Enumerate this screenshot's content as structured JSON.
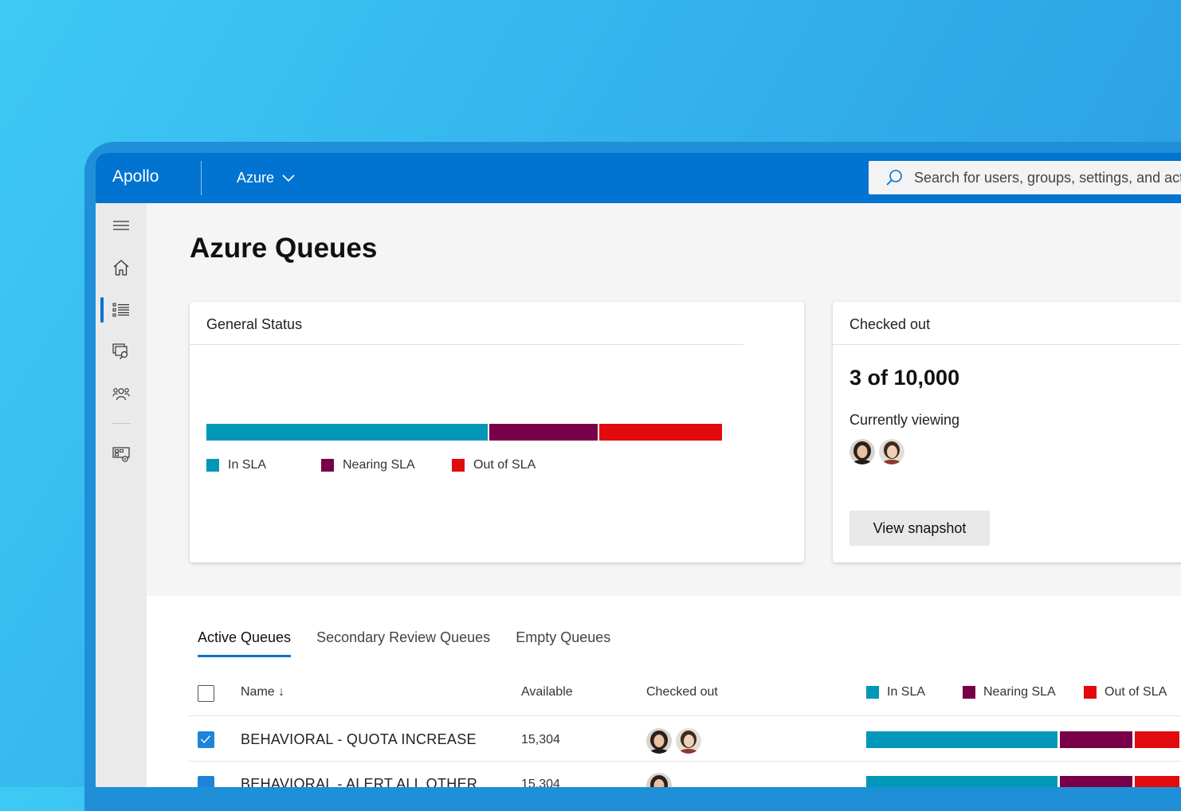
{
  "app": {
    "name": "Apollo",
    "tenant": "Azure"
  },
  "search": {
    "placeholder": "Search for users, groups, settings, and actions"
  },
  "nav": {
    "items": [
      "menu-icon",
      "home-icon",
      "queue-list-icon",
      "chat-search-icon",
      "people-icon",
      "settings-grid-icon"
    ],
    "active": "queue-list-icon"
  },
  "page": {
    "title": "Azure Queues"
  },
  "general_status": {
    "title": "General Status",
    "legend": [
      "In SLA",
      "Nearing SLA",
      "Out of SLA"
    ],
    "shares": [
      0.545,
      0.21,
      0.238
    ]
  },
  "checked_out": {
    "title": "Checked out",
    "count": "3 of 10,000",
    "viewing_label": "Currently viewing",
    "viewers": 2,
    "button": "View snapshot"
  },
  "tabs": [
    "Active Queues",
    "Secondary Review Queues",
    "Empty Queues"
  ],
  "active_tab": "Active Queues",
  "table": {
    "columns": {
      "name": "Name ↓",
      "available": "Available",
      "checked_out": "Checked out"
    },
    "legend": [
      "In SLA",
      "Nearing SLA",
      "Out of SLA"
    ],
    "rows": [
      {
        "name": "BEHAVIORAL - QUOTA INCREASE",
        "available": "15,304",
        "checked": true,
        "checked_out_avatars": 2
      },
      {
        "name": "BEHAVIORAL - ALERT ALL OTHER",
        "available": "15,304",
        "checked": true,
        "checked_out_avatars": 1
      }
    ]
  },
  "colors": {
    "accent": "#0173d1",
    "in_sla": "#0097b8",
    "nearing_sla": "#780048",
    "out_of_sla": "#e20a0e"
  }
}
